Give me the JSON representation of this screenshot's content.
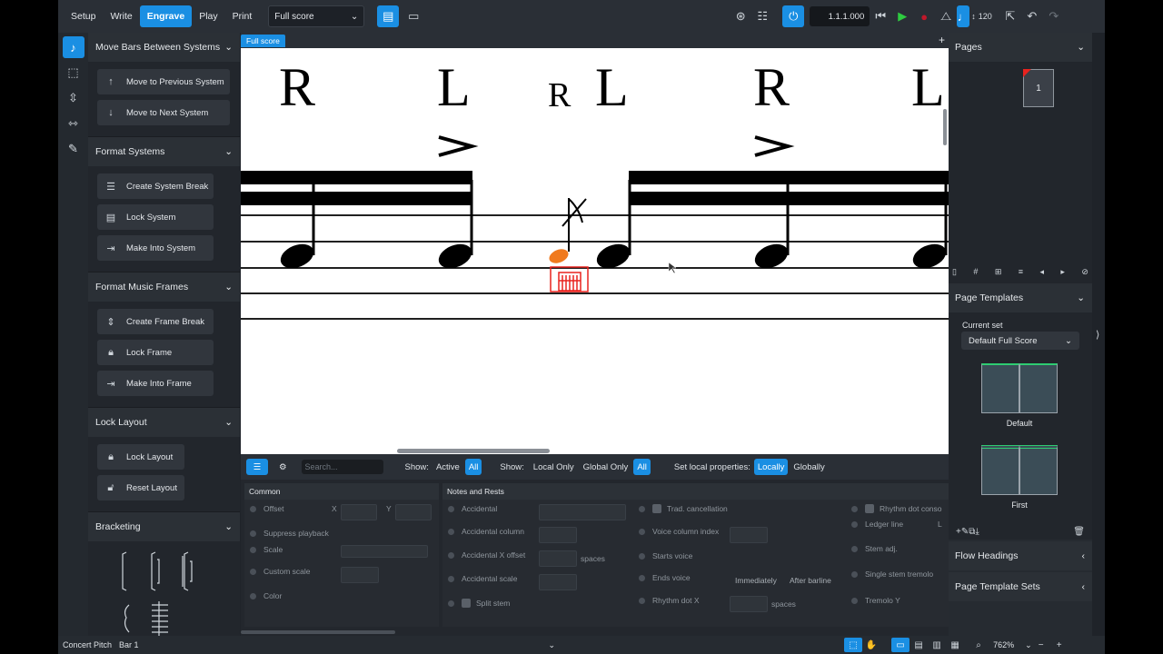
{
  "modes": [
    "Setup",
    "Write",
    "Engrave",
    "Play",
    "Print"
  ],
  "active_mode": "Engrave",
  "layout_select": "Full score",
  "transport": {
    "time": "1.1.1.000",
    "tempo": "120"
  },
  "left_panel": {
    "sections": [
      {
        "title": "Move Bars Between Systems",
        "buttons": [
          {
            "label": "Move to Previous System",
            "icon": "arrow-up-icon"
          },
          {
            "label": "Move to Next System",
            "icon": "arrow-down-icon"
          }
        ]
      },
      {
        "title": "Format Systems",
        "buttons": [
          {
            "label": "Create System Break",
            "icon": "system-break-icon"
          },
          {
            "label": "Lock System",
            "icon": "lock-system-icon"
          },
          {
            "label": "Make Into System",
            "icon": "make-into-system-icon"
          }
        ]
      },
      {
        "title": "Format Music Frames",
        "buttons": [
          {
            "label": "Create Frame Break",
            "icon": "frame-break-icon"
          },
          {
            "label": "Lock Frame",
            "icon": "lock-icon"
          },
          {
            "label": "Make Into Frame",
            "icon": "make-into-frame-icon"
          }
        ]
      },
      {
        "title": "Lock Layout",
        "buttons": [
          {
            "label": "Lock Layout",
            "icon": "lock-icon"
          },
          {
            "label": "Reset Layout",
            "icon": "unlock-icon"
          }
        ]
      },
      {
        "title": "Bracketing",
        "buttons": []
      }
    ]
  },
  "score": {
    "tab": "Full score",
    "stickings": [
      "R",
      "L",
      "R",
      "L",
      "R",
      "L"
    ]
  },
  "properties": {
    "show_label_1": "Show:",
    "active": "Active",
    "all_1": "All",
    "show_label_2": "Show:",
    "local_only": "Local Only",
    "global_only": "Global Only",
    "all_2": "All",
    "set_local_label": "Set local properties:",
    "locally": "Locally",
    "globally": "Globally",
    "search_placeholder": "Search...",
    "common": {
      "title": "Common",
      "offset": "Offset",
      "x": "X",
      "y": "Y",
      "suppress": "Suppress playback",
      "scale": "Scale",
      "custom_scale": "Custom scale",
      "color": "Color"
    },
    "notes": {
      "title": "Notes and Rests",
      "accidental": "Accidental",
      "acc_column": "Accidental column",
      "acc_x_offset": "Accidental X offset",
      "spaces": "spaces",
      "acc_scale": "Accidental scale",
      "split_stem": "Split stem",
      "trad_cancel": "Trad. cancellation",
      "voice_col": "Voice column index",
      "starts_voice": "Starts voice",
      "ends_voice": "Ends voice",
      "immediately": "Immediately",
      "after_barline": "After barline",
      "rhythm_dot_x": "Rhythm dot X",
      "spaces2": "spaces",
      "rhythm_dot_cons": "Rhythm dot conso",
      "ledger_line": "Ledger line",
      "l_short": "L",
      "stem_adj": "Stem adj.",
      "single_stem_tremolo": "Single stem tremolo",
      "tremolo_y": "Tremolo Y"
    }
  },
  "right_panel": {
    "pages_title": "Pages",
    "page_number": "1",
    "templates_title": "Page Templates",
    "current_set_label": "Current set",
    "current_set": "Default Full Score",
    "template_1": "Default",
    "template_2": "First",
    "flow_headings": "Flow Headings",
    "template_sets": "Page Template Sets"
  },
  "status": {
    "concert_pitch": "Concert Pitch",
    "bar": "Bar 1",
    "zoom": "762%"
  },
  "colors": {
    "accent": "#1a8fe3",
    "selection": "#e8231f",
    "note_highlight": "#f07a1e"
  }
}
